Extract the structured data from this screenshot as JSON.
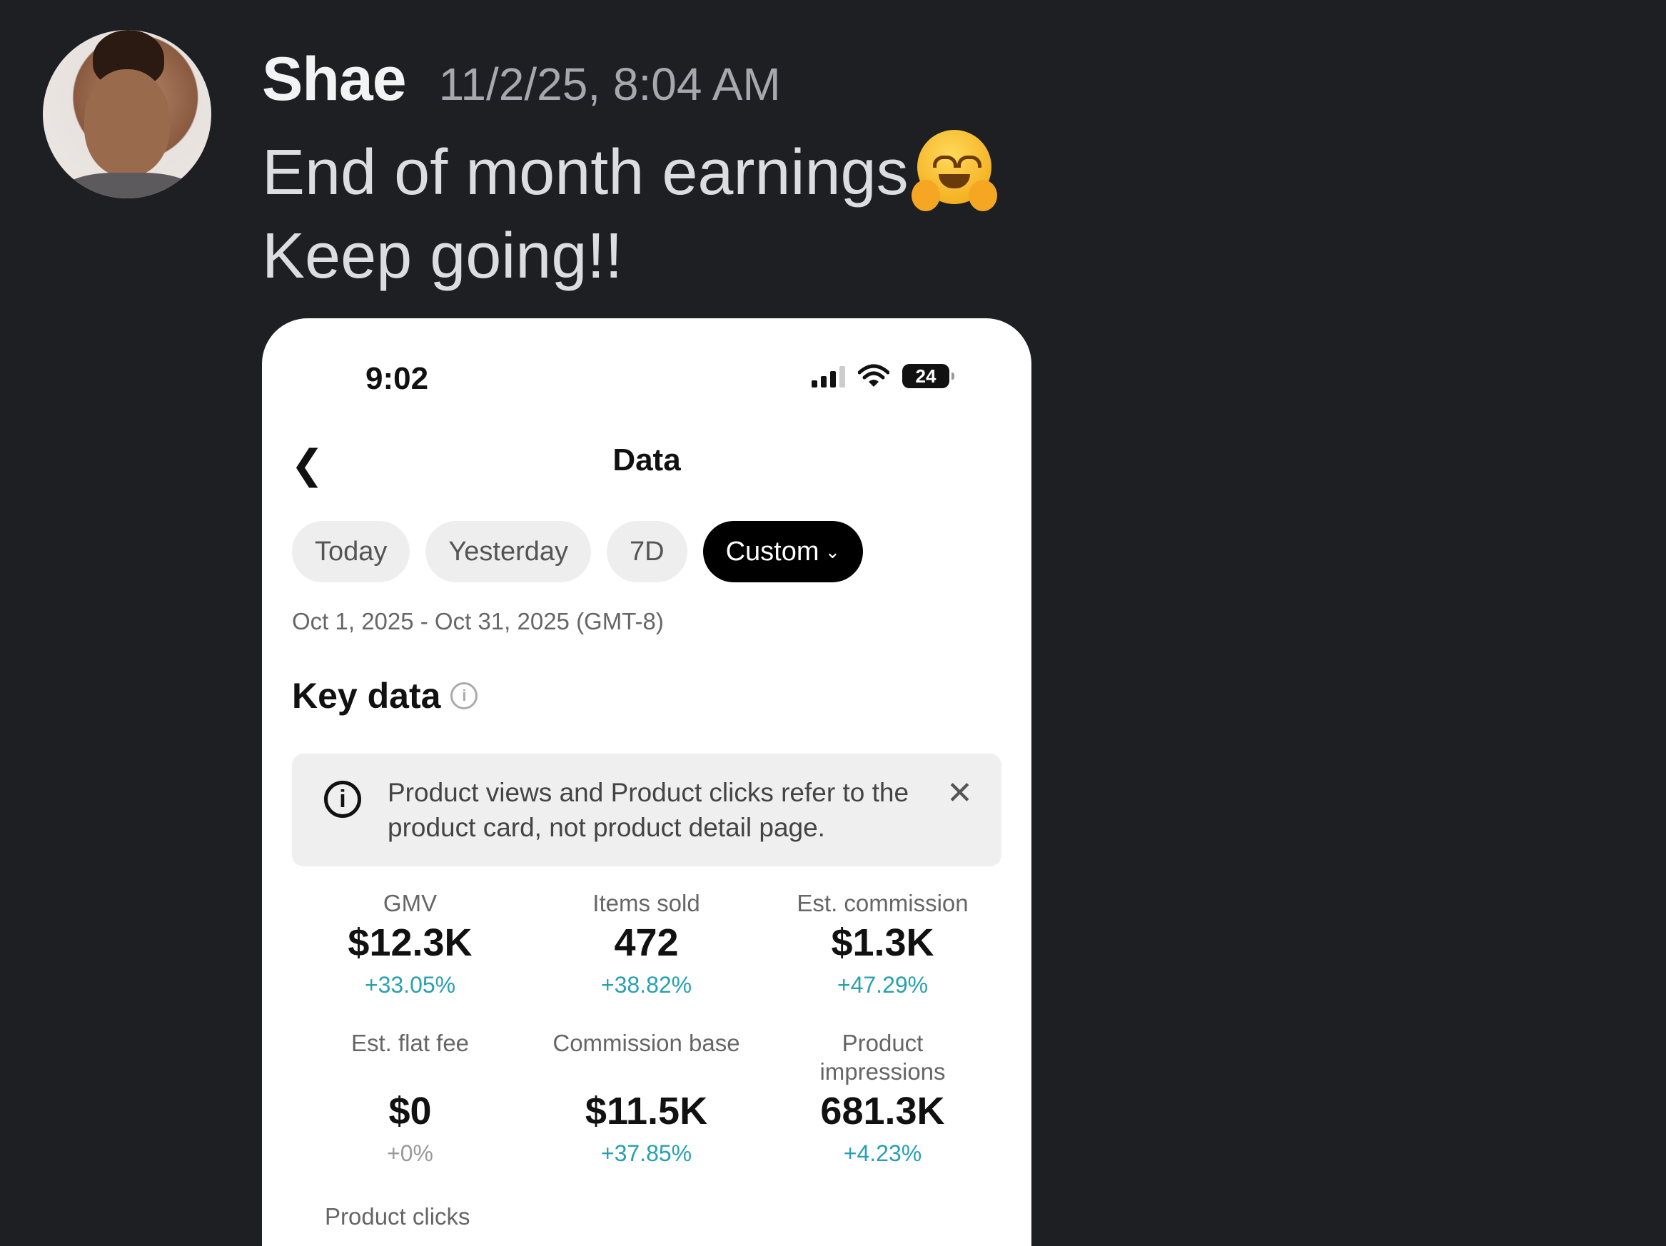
{
  "message": {
    "username": "Shae",
    "timestamp": "11/2/25, 8:04 AM",
    "line1": "End of month earnings",
    "line2": "Keep going!!",
    "emoji": "hugging-face-emoji"
  },
  "phone": {
    "status_time": "9:02",
    "battery": "24",
    "title": "Data",
    "pills": [
      "Today",
      "Yesterday",
      "7D",
      "Custom"
    ],
    "date_range": "Oct 1, 2025 - Oct 31, 2025 (GMT-8)",
    "section_title": "Key data",
    "notice": "Product views and Product clicks refer to the product card, not product detail page.",
    "metrics": [
      {
        "label": "GMV",
        "value": "$12.3K",
        "change": "+33.05%"
      },
      {
        "label": "Items sold",
        "value": "472",
        "change": "+38.82%"
      },
      {
        "label": "Est. commission",
        "value": "$1.3K",
        "change": "+47.29%"
      },
      {
        "label": "Est. flat fee",
        "value": "$0",
        "change": "+0%"
      },
      {
        "label": "Commission base",
        "value": "$11.5K",
        "change": "+37.85%"
      },
      {
        "label": "Product impressions",
        "value": "681.3K",
        "change": "+4.23%"
      }
    ],
    "next_label": "Product clicks"
  }
}
